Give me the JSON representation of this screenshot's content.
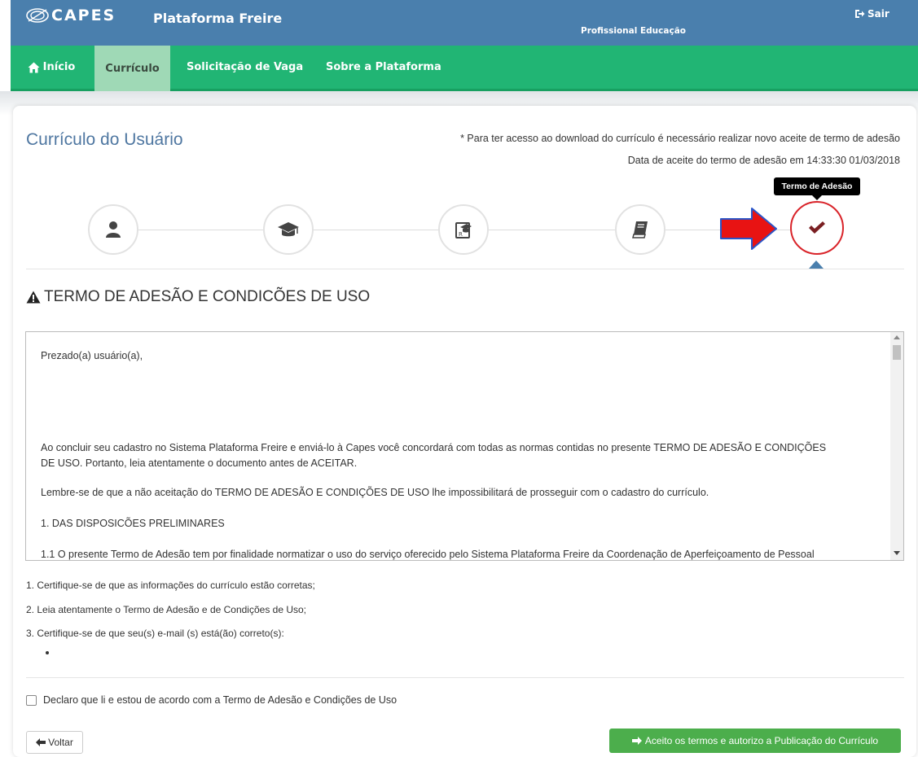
{
  "header": {
    "brand": "CAPES",
    "platform_title": "Plataforma Freire",
    "profile": "Profissional Educação",
    "logout_label": "Sair"
  },
  "nav": {
    "items": [
      {
        "label": "Início",
        "icon": "home-icon",
        "active": false
      },
      {
        "label": "Currículo",
        "active": true
      },
      {
        "label": "Solicitação de Vaga",
        "active": false
      },
      {
        "label": "Sobre a Plataforma",
        "active": false
      }
    ]
  },
  "main": {
    "title": "Currículo do Usuário",
    "notice": "* Para ter acesso ao download do currículo é necessário realizar novo aceite de termo de adesão",
    "accept_date": "Data de aceite do termo de adesão em 14:33:30 01/03/2018",
    "tooltip": "Termo de Adesão",
    "steps": [
      {
        "icon": "user-icon"
      },
      {
        "icon": "graduation-cap-icon"
      },
      {
        "icon": "certificate-icon"
      },
      {
        "icon": "book-icon"
      },
      {
        "icon": "check-icon",
        "active": true
      }
    ],
    "section_title": "TERMO DE ADESÃO E CONDICÕES DE USO",
    "terms": {
      "greeting": "Prezado(a) usuário(a),",
      "p1_line1": "Ao concluir seu cadastro no Sistema Plataforma Freire e enviá-lo à Capes você concordará com todas as normas contidas no presente TERMO DE ADESÃO E CONDIÇÕES",
      "p1_line2": "DE USO.  Portanto, leia atentamente o documento antes de ACEITAR.",
      "p2": "Lembre-se de que a não aceitação do TERMO DE ADESÃO E CONDIÇÕES DE USO lhe impossibilitará de prosseguir com o cadastro do currículo.",
      "h1": "1. DAS DISPOSICÕES PRELIMINARES",
      "p3": "1.1   O presente Termo de Adesão tem por finalidade normatizar o uso do serviço oferecido pelo Sistema Plataforma Freire da Coordenação de Aperfeiçoamento de Pessoal"
    },
    "instructions": [
      "1. Certifique-se de que as informações do currículo estão corretas;",
      "2. Leia atentamente o Termo de Adesão e de Condições de Uso;",
      "3. Certifique-se de que seu(s) e-mail (s) está(ão) correto(s):"
    ],
    "declare_label": "Declaro que li e estou de acordo com a Termo de Adesão e Condições de Uso",
    "back_label": "Voltar",
    "accept_label": "Aceito os termos e autorizo a Publicação do Currículo"
  },
  "colors": {
    "topbar": "#4a7fad",
    "navbar": "#21b574",
    "active_tab": "#9fd9b6",
    "title": "#4f77a1",
    "accept_button": "#4cae4c",
    "active_step": "#d9242a",
    "check": "#7a1f22",
    "arrow": "#e81313"
  }
}
